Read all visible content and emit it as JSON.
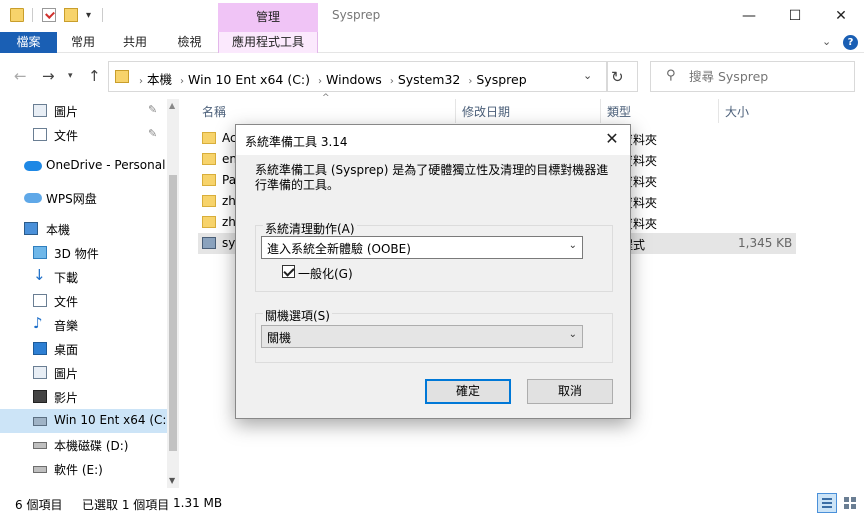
{
  "titlebar": {
    "manage_tab": "管理",
    "window_title": "Sysprep",
    "minimize": "—",
    "maximize": "☐",
    "close": "✕"
  },
  "ribbon": {
    "tabs": [
      "檔案",
      "常用",
      "共用",
      "檢視",
      "應用程式工具"
    ]
  },
  "address": {
    "crumbs": [
      "本機",
      "Win 10 Ent x64 (C:)",
      "Windows",
      "System32",
      "Sysprep"
    ],
    "search_placeholder": "搜尋 Sysprep"
  },
  "sidebar": {
    "items": [
      {
        "label": "圖片",
        "icon": "pictures-icon",
        "pinned": true
      },
      {
        "label": "文件",
        "icon": "documents-icon",
        "pinned": true
      },
      {
        "label": "OneDrive - Personal",
        "icon": "onedrive-icon"
      },
      {
        "label": "WPS网盘",
        "icon": "wps-cloud-icon"
      },
      {
        "label": "本機",
        "icon": "this-pc-icon"
      },
      {
        "label": "3D 物件",
        "icon": "3d-objects-icon"
      },
      {
        "label": "下載",
        "icon": "downloads-icon"
      },
      {
        "label": "文件",
        "icon": "documents-icon"
      },
      {
        "label": "音樂",
        "icon": "music-icon"
      },
      {
        "label": "桌面",
        "icon": "desktop-icon"
      },
      {
        "label": "圖片",
        "icon": "pictures-icon"
      },
      {
        "label": "影片",
        "icon": "videos-icon"
      },
      {
        "label": "Win 10 Ent x64 (C:)",
        "icon": "system-drive-icon"
      },
      {
        "label": "本機磁碟 (D:)",
        "icon": "drive-icon"
      },
      {
        "label": "軟件 (E:)",
        "icon": "drive-icon"
      }
    ]
  },
  "filelist": {
    "columns": [
      "名稱",
      "修改日期",
      "類型",
      "大小"
    ],
    "rows": [
      {
        "name": "Ac",
        "type": "資料夾",
        "size": ""
      },
      {
        "name": "en",
        "type": "資料夾",
        "size": ""
      },
      {
        "name": "Pa",
        "type": "資料夾",
        "size": ""
      },
      {
        "name": "zh",
        "type": "資料夾",
        "size": ""
      },
      {
        "name": "zh",
        "type": "資料夾",
        "size": ""
      },
      {
        "name": "sys",
        "type": "程式",
        "size": "1,345 KB"
      }
    ]
  },
  "status": {
    "count": "6 個項目",
    "selected": "已選取 1 個項目",
    "size": "1.31 MB"
  },
  "dialog": {
    "title": "系統準備工具 3.14",
    "description": "系統準備工具 (Sysprep) 是為了硬體獨立性及清理的目標對機器進行準備的工具。",
    "cleanup_group": "系統清理動作(A)",
    "cleanup_value": "進入系統全新體驗 (OOBE)",
    "generalize_label": "一般化(G)",
    "generalize_checked": true,
    "shutdown_group": "關機選項(S)",
    "shutdown_value": "關機",
    "ok": "確定",
    "cancel": "取消",
    "close": "✕"
  }
}
